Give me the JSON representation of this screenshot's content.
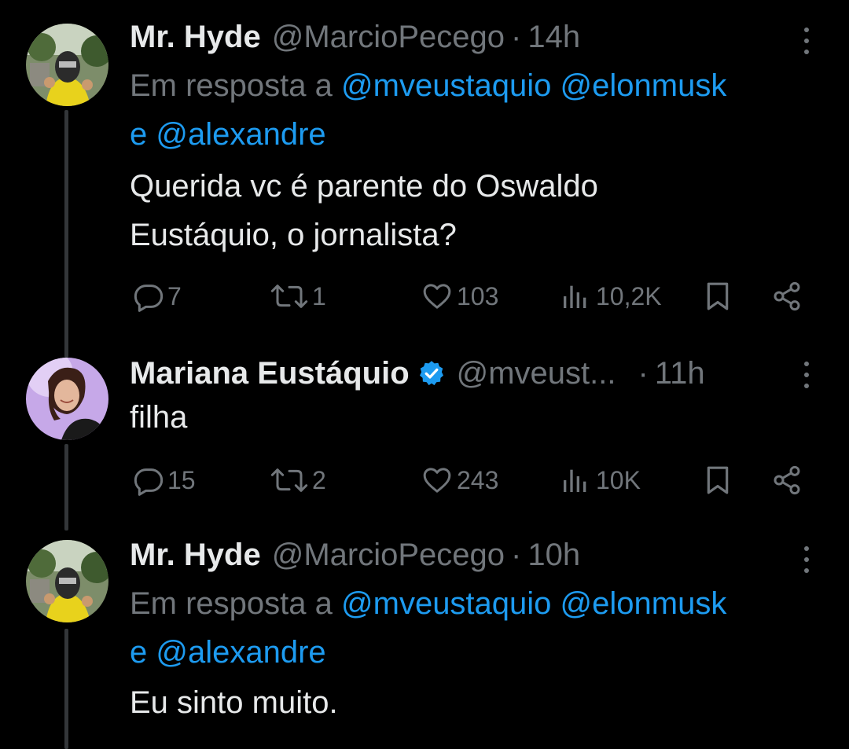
{
  "colors": {
    "background": "#000000",
    "text": "#e7e9ea",
    "secondary": "#71767b",
    "link": "#1d9bf0",
    "thread_line": "#333639"
  },
  "tweets": [
    {
      "name": "Mr. Hyde",
      "handle": "@MarcioPecego",
      "dot": "·",
      "time": "14h",
      "verified": false,
      "avatar_icon": "avatar-photo-helmet-yellow-shirt",
      "reply": {
        "prefix": "Em resposta a",
        "mention1": "@mveustaquio",
        "mention2": "@elonmusk",
        "conjunction": "e",
        "mention3": "@alexandre"
      },
      "text_line1": "Querida vc é parente do Oswaldo",
      "text_line2": "Eustáquio, o jornalista?",
      "actions": {
        "replies": "7",
        "retweets": "1",
        "likes": "103",
        "views": "10,2K"
      }
    },
    {
      "name": "Mariana Eustáquio",
      "handle": "@mveust...",
      "dot": "·",
      "time": "11h",
      "verified": true,
      "avatar_icon": "avatar-photo-woman-purple",
      "text_line1": "filha",
      "actions": {
        "replies": "15",
        "retweets": "2",
        "likes": "243",
        "views": "10K"
      }
    },
    {
      "name": "Mr. Hyde",
      "handle": "@MarcioPecego",
      "dot": "·",
      "time": "10h",
      "verified": false,
      "avatar_icon": "avatar-photo-helmet-yellow-shirt",
      "reply": {
        "prefix": "Em resposta a",
        "mention1": "@mveustaquio",
        "mention2": "@elonmusk",
        "conjunction": "e",
        "mention3": "@alexandre"
      },
      "text_line1": "Eu sinto muito."
    }
  ]
}
